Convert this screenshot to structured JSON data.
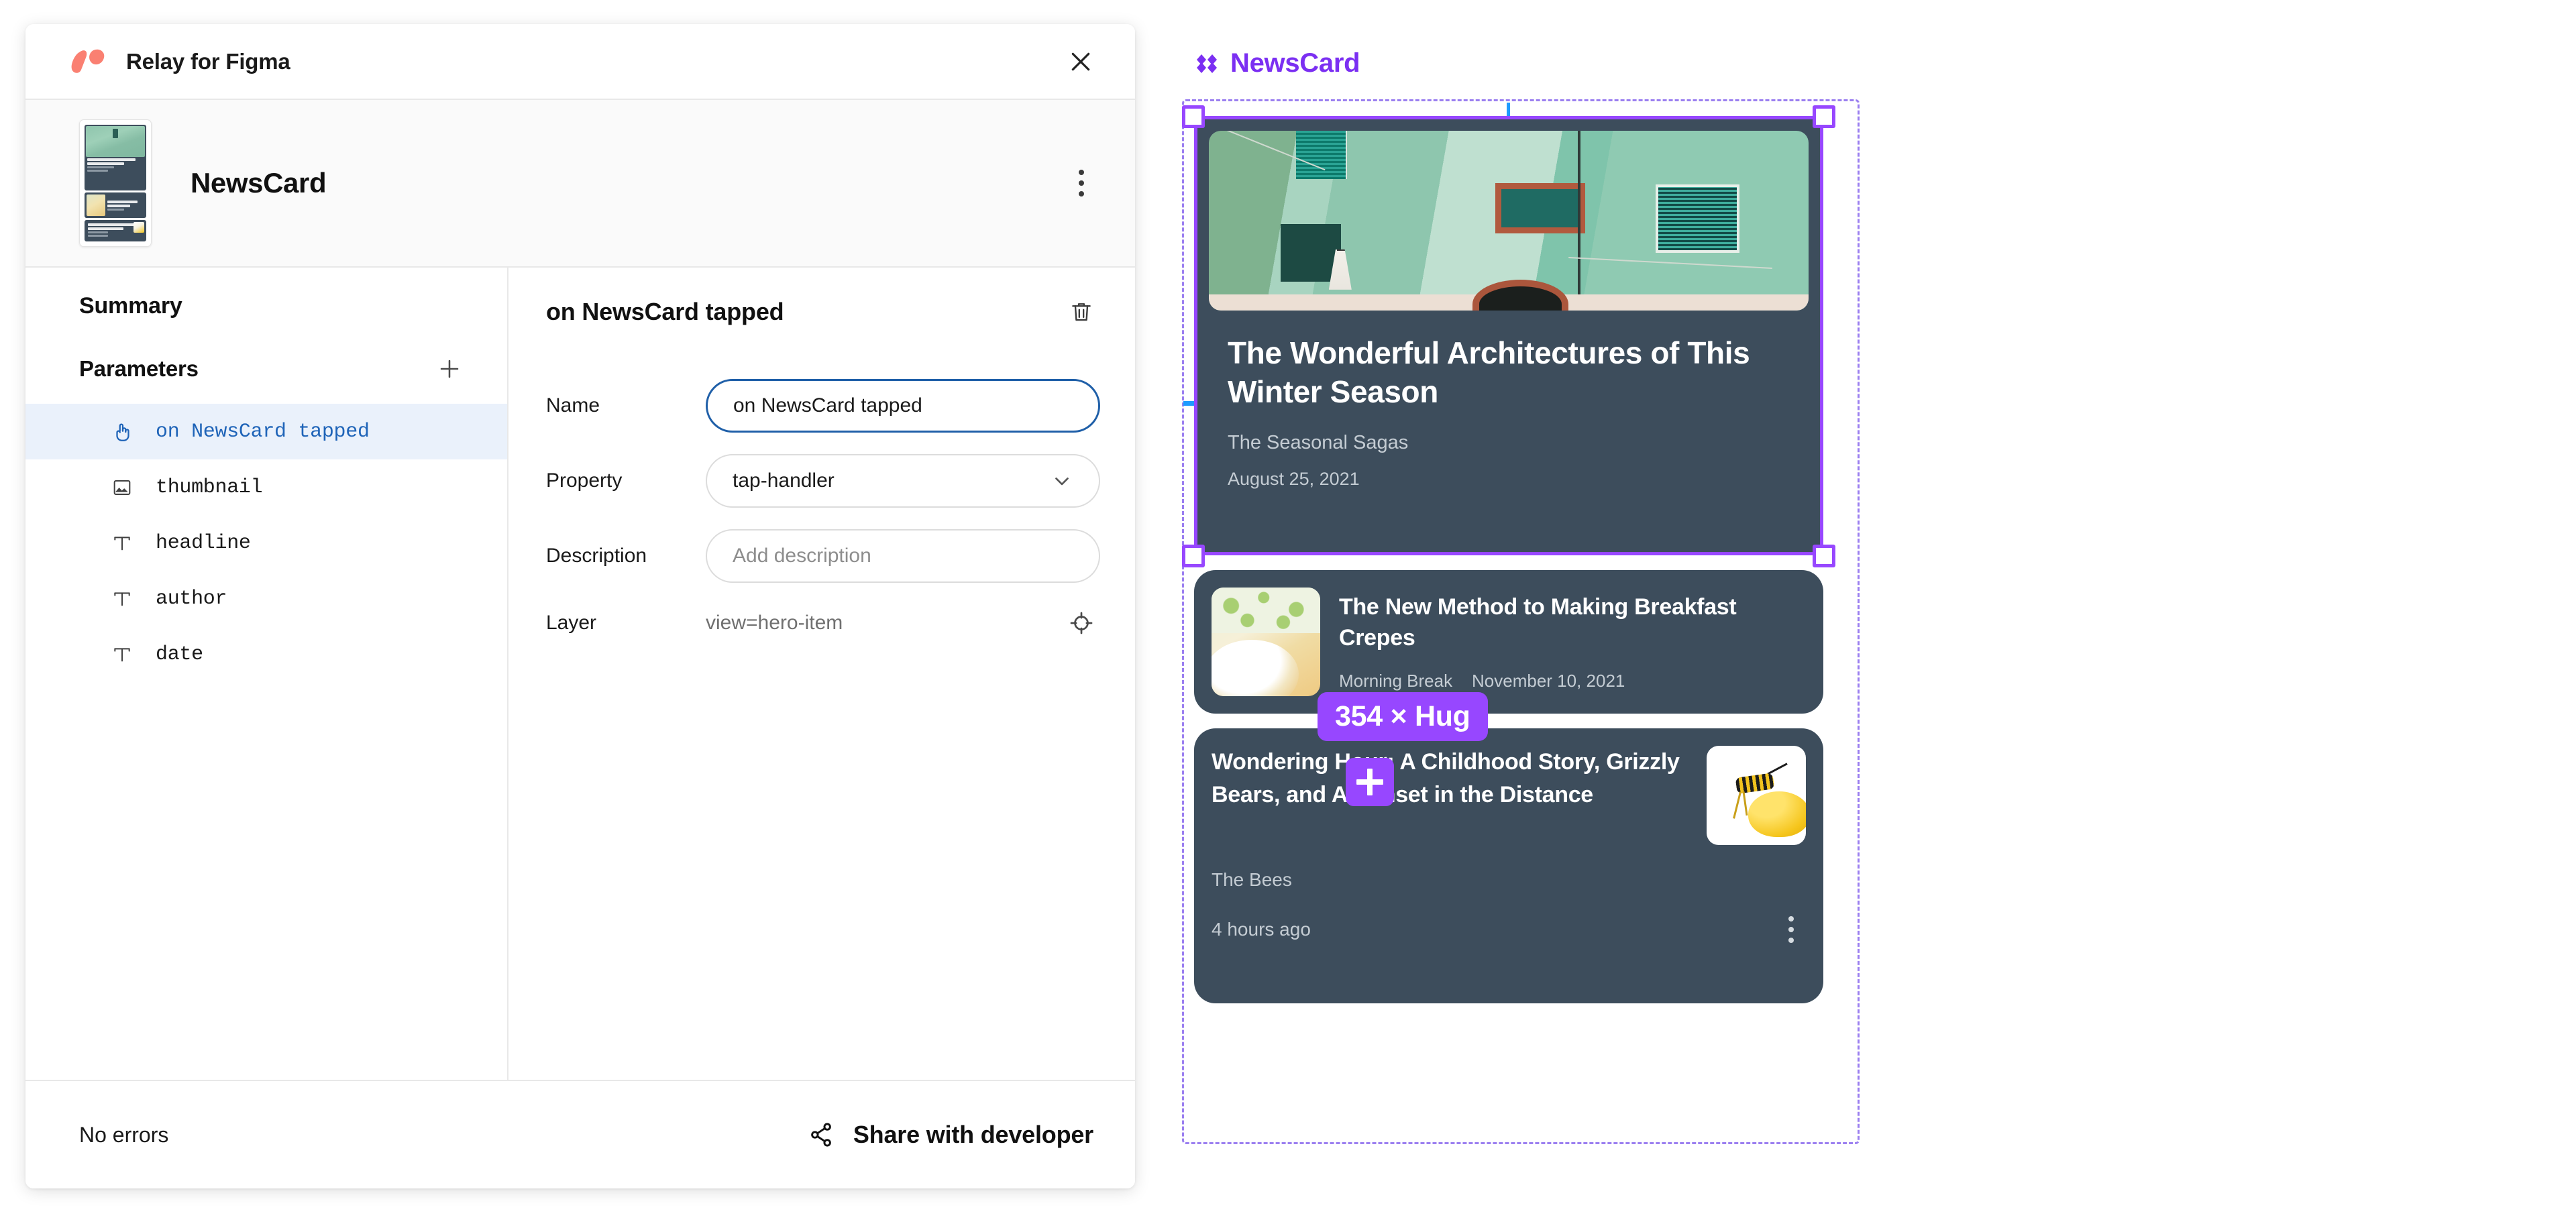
{
  "plugin": {
    "title": "Relay for Figma",
    "logo_icon": "relay-logo",
    "close_icon": "close-icon",
    "component": {
      "name": "NewsCard",
      "thumbnail_icon": "component-thumbnail",
      "menu_icon": "kebab-menu-icon"
    },
    "summary_label": "Summary",
    "parameters_label": "Parameters",
    "add_parameter_icon": "plus-icon",
    "parameters": [
      {
        "label": "on NewsCard tapped",
        "icon": "tap-handler-icon",
        "selected": true
      },
      {
        "label": "thumbnail",
        "icon": "image-icon",
        "selected": false
      },
      {
        "label": "headline",
        "icon": "text-icon",
        "selected": false
      },
      {
        "label": "author",
        "icon": "text-icon",
        "selected": false
      },
      {
        "label": "date",
        "icon": "text-icon",
        "selected": false
      }
    ],
    "detail": {
      "title": "on NewsCard tapped",
      "delete_icon": "trash-icon",
      "name_label": "Name",
      "name_value": "on NewsCard tapped",
      "property_label": "Property",
      "property_value": "tap-handler",
      "property_chevron_icon": "chevron-down-icon",
      "description_label": "Description",
      "description_value": "",
      "description_placeholder": "Add description",
      "layer_label": "Layer",
      "layer_value": "view=hero-item",
      "layer_locate_icon": "crosshair-icon"
    },
    "footer": {
      "status": "No errors",
      "share_label": "Share with developer",
      "share_icon": "share-icon"
    }
  },
  "canvas": {
    "component_label": "NewsCard",
    "component_label_icon": "component-diamond-icon",
    "selection_color": "#9747FF",
    "frame_outline_color": "#9b7ff0",
    "guide_color": "#1E9BFF",
    "card_bg_color": "#3d4d5c",
    "size_badge": "354 × Hug",
    "add_button_icon": "plus-icon",
    "cards": [
      {
        "headline": "The Wonderful Architectures of This Winter Season",
        "author": "The Seasonal Sagas",
        "date": "August 25, 2021",
        "image_icon": "green-building-facade-photo"
      },
      {
        "headline": "The New Method to Making Breakfast Crepes",
        "author": "Morning Break",
        "date": "November 10, 2021",
        "image_icon": "breakfast-crepes-photo"
      },
      {
        "headline": "Wondering Hour: A Childhood Story, Grizzly Bears, and A Sunset in the Distance",
        "author": "The Bees",
        "date": "4 hours ago",
        "image_icon": "bee-photo",
        "menu_icon": "kebab-menu-icon"
      }
    ]
  }
}
